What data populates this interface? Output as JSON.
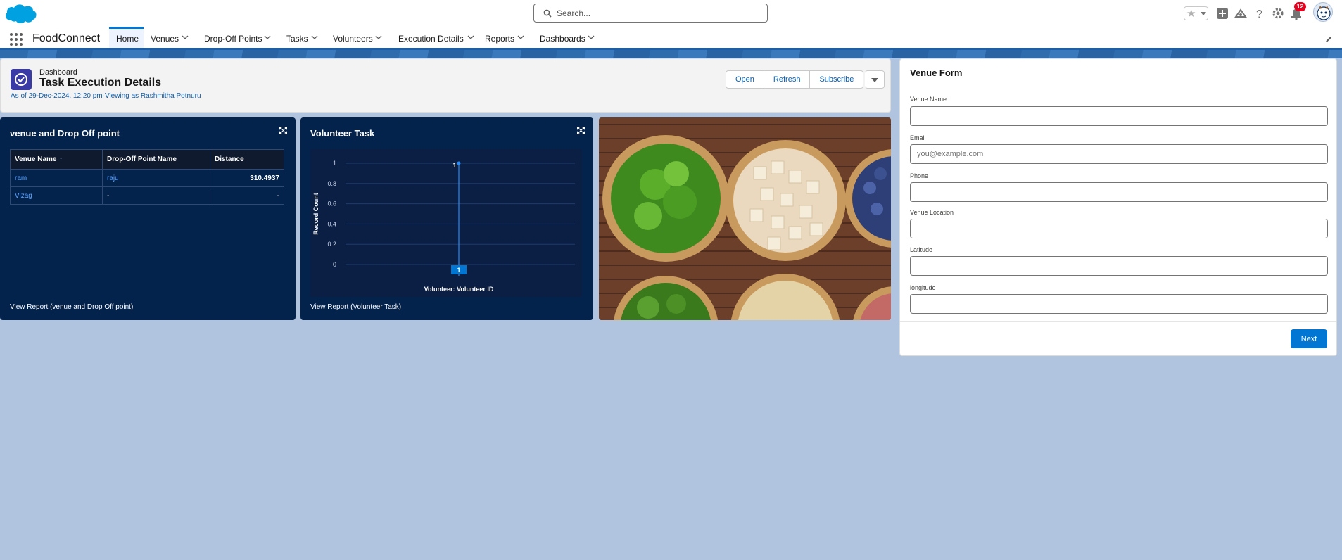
{
  "header": {
    "search_placeholder": "Search...",
    "notification_count": "12"
  },
  "nav": {
    "app_name": "FoodConnect",
    "items": [
      {
        "label": "Home",
        "active": true
      },
      {
        "label": "Venues"
      },
      {
        "label": "Drop-Off Points"
      },
      {
        "label": "Tasks"
      },
      {
        "label": "Volunteers"
      },
      {
        "label": "Execution Details"
      },
      {
        "label": "Reports"
      },
      {
        "label": "Dashboards"
      }
    ]
  },
  "dashboard": {
    "type_label": "Dashboard",
    "title": "Task Execution Details",
    "subtitle": "As of 29-Dec-2024, 12:20 pm·Viewing as Rashmitha Potnuru",
    "buttons": {
      "open": "Open",
      "refresh": "Refresh",
      "subscribe": "Subscribe"
    }
  },
  "widget_table": {
    "title": "venue and Drop Off point",
    "columns": [
      "Venue Name",
      "Drop-Off Point Name",
      "Distance"
    ],
    "sort_indicator": "↑",
    "rows": [
      [
        "ram",
        "raju",
        "310.4937"
      ],
      [
        "Vizag",
        "-",
        "-"
      ]
    ],
    "footer": "View Report (venue and Drop Off point)"
  },
  "widget_chart": {
    "title": "Volunteer Task",
    "footer": "View Report (Volunteer Task)"
  },
  "chart_data": {
    "type": "line",
    "title": "Volunteer Task",
    "xlabel": "Volunteer: Volunteer ID",
    "ylabel": "Record Count",
    "yticks": [
      "1",
      "0.8",
      "0.6",
      "0.4",
      "0.2",
      "0"
    ],
    "ylim": [
      0,
      1
    ],
    "x": [
      "1"
    ],
    "series": [
      {
        "values": [
          1
        ]
      }
    ],
    "data_labels": [
      "1"
    ],
    "grid": true
  },
  "form": {
    "title": "Venue Form",
    "fields": {
      "venue_name": {
        "label": "Venue Name",
        "value": "",
        "placeholder": ""
      },
      "email": {
        "label": "Email",
        "value": "",
        "placeholder": "you@example.com"
      },
      "phone": {
        "label": "Phone",
        "value": "",
        "placeholder": ""
      },
      "venue_location": {
        "label": "Venue Location",
        "value": "",
        "placeholder": ""
      },
      "latitude": {
        "label": "Latitude",
        "value": "",
        "placeholder": ""
      },
      "longitude": {
        "label": "longitude",
        "value": "",
        "placeholder": ""
      }
    },
    "next_label": "Next"
  },
  "colors": {
    "brand": "#0176d3",
    "widget_bg": "#03234d",
    "page_bg": "#b0c4df",
    "link": "#5aa2ff"
  }
}
